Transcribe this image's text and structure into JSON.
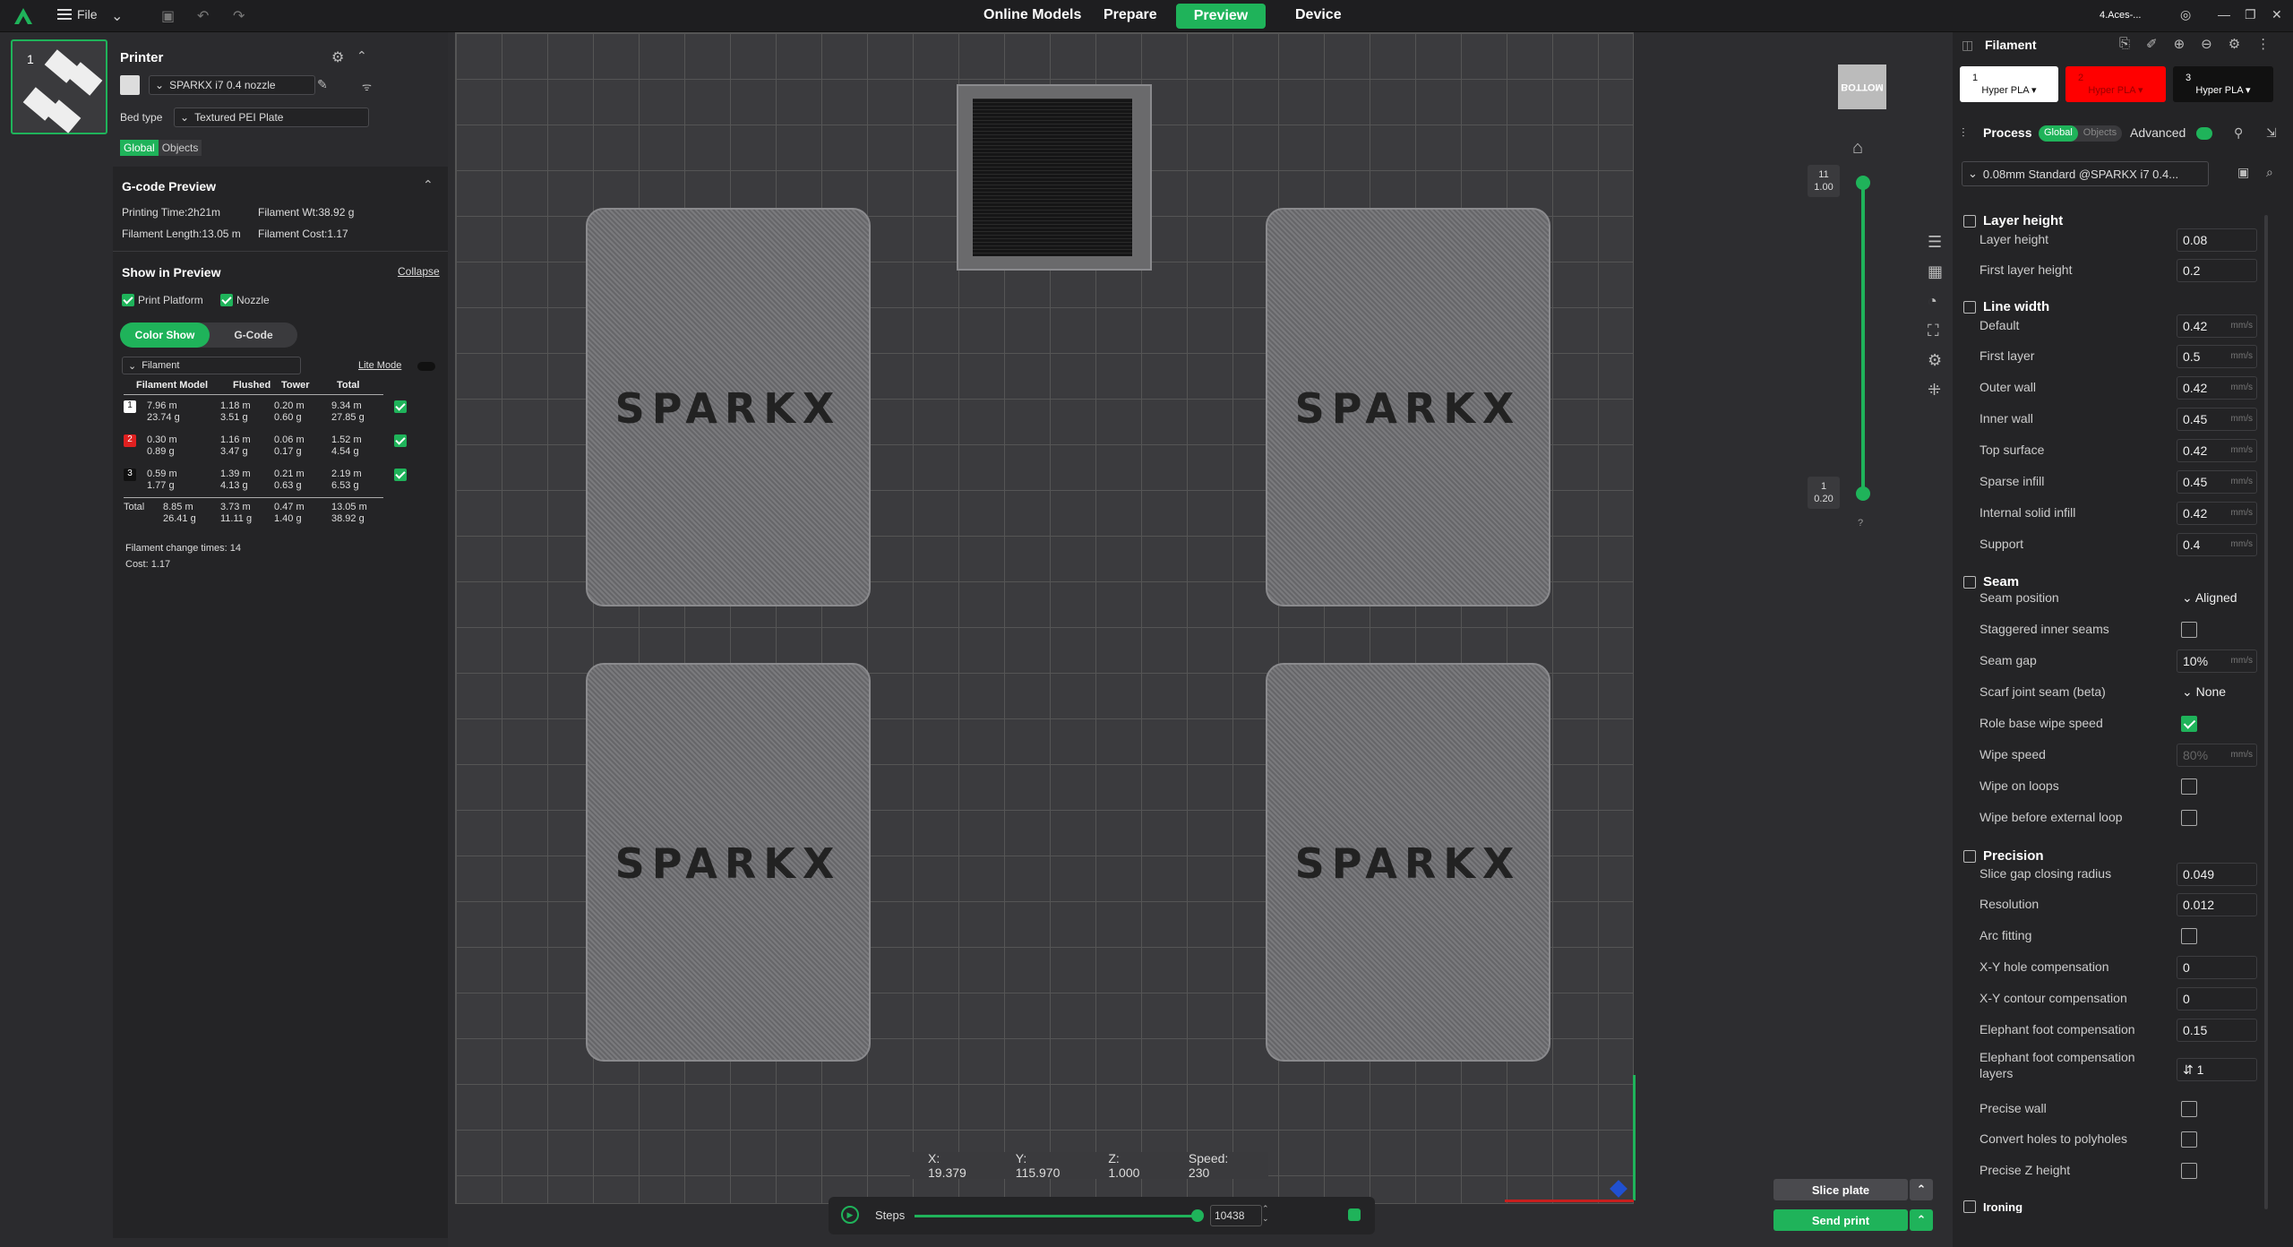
{
  "topbar": {
    "file_label": "File",
    "tabs": [
      "Online Models",
      "Prepare",
      "Preview",
      "Device"
    ],
    "active_tab": "Preview",
    "account": "4.Aces-..."
  },
  "plate": {
    "number": "1"
  },
  "printer": {
    "title": "Printer",
    "model": "SPARKX i7 0.4 nozzle",
    "bed_type_label": "Bed type",
    "bed_type": "Textured PEI Plate",
    "tab_global": "Global",
    "tab_objects": "Objects"
  },
  "gcode": {
    "title": "G-code Preview",
    "printing_time": "Printing Time:2h21m",
    "filament_wt": "Filament Wt:38.92 g",
    "filament_length": "Filament Length:13.05 m",
    "filament_cost": "Filament Cost:1.17",
    "show_title": "Show in Preview",
    "collapse": "Collapse",
    "print_platform": "Print Platform",
    "nozzle": "Nozzle",
    "color_show": "Color Show",
    "gcode_btn": "G-Code",
    "filament_dropdown": "Filament",
    "lite_mode": "Lite Mode",
    "headers": [
      "Filament Model",
      "Flushed",
      "Tower",
      "Total"
    ],
    "rows": [
      {
        "id": "1",
        "model": "7.96 m\n23.74 g",
        "flushed": "1.18 m\n3.51 g",
        "tower": "0.20 m\n0.60 g",
        "total": "9.34 m\n27.85 g",
        "color": "#ffffff"
      },
      {
        "id": "2",
        "model": "0.30 m\n0.89 g",
        "flushed": "1.16 m\n3.47 g",
        "tower": "0.06 m\n0.17 g",
        "total": "1.52 m\n4.54 g",
        "color": "#e02020"
      },
      {
        "id": "3",
        "model": "0.59 m\n1.77 g",
        "flushed": "1.39 m\n4.13 g",
        "tower": "0.21 m\n0.63 g",
        "total": "2.19 m\n6.53 g",
        "color": "#111111"
      }
    ],
    "total_label": "Total",
    "total": {
      "model": "8.85 m\n26.41 g",
      "flushed": "3.73 m\n11.11 g",
      "tower": "0.47 m\n1.40 g",
      "total": "13.05 m\n38.92 g"
    },
    "change_times": "Filament change times:  14",
    "cost": "Cost:  1.17"
  },
  "viewport": {
    "card_text": "SPARKX",
    "view_cube": "BOTTOM",
    "layer_top": "11\n1.00",
    "layer_bottom": "1\n0.20",
    "help": "?",
    "coords": {
      "x": "X: 19.379",
      "y": "Y: 115.970",
      "z": "Z: 1.000",
      "speed": "Speed: 230"
    },
    "steps_label": "Steps",
    "steps_value": "10438",
    "layer_progress": 1.0,
    "step_progress": 1.0
  },
  "actions": {
    "slice": "Slice plate",
    "send": "Send print"
  },
  "right": {
    "filament_title": "Filament",
    "slots": [
      {
        "num": "1",
        "name": "Hyper PLA",
        "color": "#ffffff",
        "text": "#111111"
      },
      {
        "num": "2",
        "name": "Hyper PLA",
        "color": "#ff0000",
        "text": "#990000"
      },
      {
        "num": "3",
        "name": "Hyper PLA",
        "color": "#111111",
        "text": "#ffffff"
      }
    ],
    "process_title": "Process",
    "process_global": "Global",
    "process_objects": "Objects",
    "advanced": "Advanced",
    "preset": "0.08mm Standard @SPARKX i7 0.4...",
    "sections": {
      "layer_height": "Layer height",
      "line_width": "Line width",
      "seam": "Seam",
      "precision": "Precision",
      "ironing": "Ironing"
    },
    "unit_mm": "mm/s",
    "settings": {
      "layer_height": {
        "label": "Layer height",
        "value": "0.08"
      },
      "first_layer_height": {
        "label": "First layer height",
        "value": "0.2"
      },
      "default": {
        "label": "Default",
        "value": "0.42"
      },
      "first_layer": {
        "label": "First layer",
        "value": "0.5"
      },
      "outer_wall": {
        "label": "Outer wall",
        "value": "0.42"
      },
      "inner_wall": {
        "label": "Inner wall",
        "value": "0.45"
      },
      "top_surface": {
        "label": "Top surface",
        "value": "0.42"
      },
      "sparse_infill": {
        "label": "Sparse infill",
        "value": "0.45"
      },
      "internal_solid_infill": {
        "label": "Internal solid infill",
        "value": "0.42"
      },
      "support": {
        "label": "Support",
        "value": "0.4"
      },
      "seam_position": {
        "label": "Seam position",
        "value": "Aligned"
      },
      "staggered": {
        "label": "Staggered inner seams"
      },
      "seam_gap": {
        "label": "Seam gap",
        "value": "10%"
      },
      "scarf": {
        "label": "Scarf joint seam (beta)",
        "value": "None"
      },
      "role_wipe": {
        "label": "Role base wipe speed"
      },
      "wipe_speed": {
        "label": "Wipe speed",
        "value": "80%",
        "unit": "mm/s"
      },
      "wipe_loops": {
        "label": "Wipe on loops"
      },
      "wipe_before": {
        "label": "Wipe before external loop"
      },
      "slice_gap": {
        "label": "Slice gap closing radius",
        "value": "0.049"
      },
      "resolution": {
        "label": "Resolution",
        "value": "0.012"
      },
      "arc_fitting": {
        "label": "Arc fitting"
      },
      "xy_hole": {
        "label": "X-Y hole compensation",
        "value": "0"
      },
      "xy_contour": {
        "label": "X-Y contour compensation",
        "value": "0"
      },
      "elephant": {
        "label": "Elephant foot compensation",
        "value": "0.15"
      },
      "elephant_layers": {
        "label": "Elephant foot compensation\nlayers",
        "value": "1"
      },
      "precise_wall": {
        "label": "Precise wall"
      },
      "convert_holes": {
        "label": "Convert holes to polyholes"
      },
      "precise_z": {
        "label": "Precise Z height"
      }
    }
  },
  "colors": {
    "accent": "#1fb35a",
    "bg": "#2b2b2e",
    "panel": "#242426"
  }
}
